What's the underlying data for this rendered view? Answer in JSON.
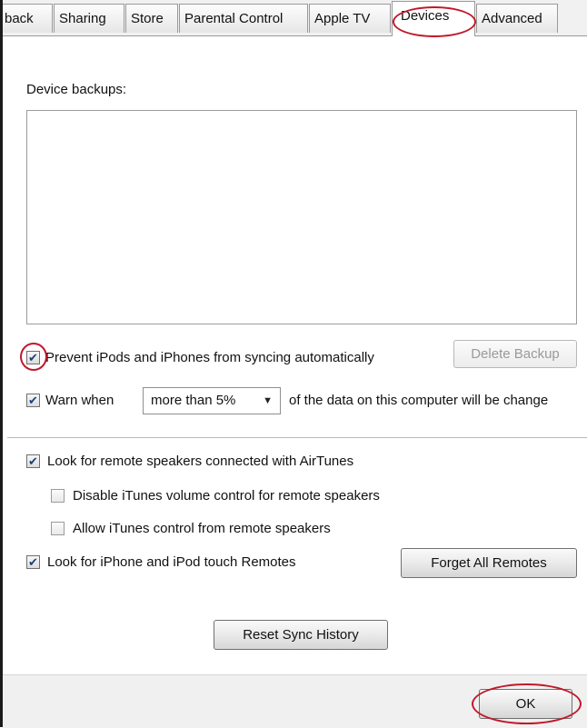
{
  "tabs": [
    {
      "label": "back"
    },
    {
      "label": "Sharing"
    },
    {
      "label": "Store"
    },
    {
      "label": "Parental Control"
    },
    {
      "label": "Apple TV"
    },
    {
      "label": "Devices",
      "active": true
    },
    {
      "label": "Advanced"
    }
  ],
  "device_backups": {
    "label": "Device backups:",
    "items": []
  },
  "prevent_sync": {
    "label": "Prevent iPods and iPhones from syncing automatically",
    "checked": true
  },
  "delete_backup": {
    "label": "Delete Backup",
    "enabled": false
  },
  "warn": {
    "label": "Warn when",
    "selected": "more than 5%",
    "suffix": "of the data on this computer will be change",
    "checked": true
  },
  "airtunes": {
    "label": "Look for remote speakers connected with AirTunes",
    "checked": true
  },
  "disable_volume": {
    "label": "Disable iTunes volume control for remote speakers",
    "checked": false
  },
  "allow_control": {
    "label": "Allow iTunes control from remote speakers",
    "checked": false
  },
  "remotes": {
    "label": "Look for iPhone and iPod touch Remotes",
    "checked": true
  },
  "forget_remotes": {
    "label": "Forget All Remotes"
  },
  "reset_sync": {
    "label": "Reset Sync History"
  },
  "ok": {
    "label": "OK"
  },
  "colors": {
    "annotation": "#c0182a",
    "check": "#1d3e7a"
  }
}
